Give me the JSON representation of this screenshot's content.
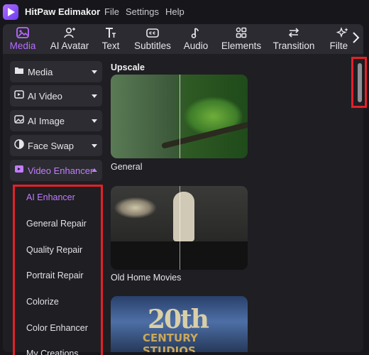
{
  "app": {
    "title": "HitPaw Edimakor"
  },
  "menu": [
    "File",
    "Settings",
    "Help"
  ],
  "toolbar": {
    "tabs": [
      {
        "label": "Media",
        "icon": "media-icon",
        "active": true
      },
      {
        "label": "AI Avatar",
        "icon": "avatar-icon",
        "active": false
      },
      {
        "label": "Text",
        "icon": "text-icon",
        "active": false
      },
      {
        "label": "Subtitles",
        "icon": "subtitles-icon",
        "active": false
      },
      {
        "label": "Audio",
        "icon": "music-note-icon",
        "active": false
      },
      {
        "label": "Elements",
        "icon": "elements-icon",
        "active": false
      },
      {
        "label": "Transition",
        "icon": "transition-icon",
        "active": false
      },
      {
        "label": "Filters",
        "icon": "filters-icon",
        "active": false
      }
    ],
    "more_icon": "chevron-right-icon"
  },
  "sidebar": {
    "categories": [
      {
        "label": "Media",
        "icon": "folder-icon",
        "expanded": false
      },
      {
        "label": "AI Video",
        "icon": "ai-video-icon",
        "expanded": false
      },
      {
        "label": "AI Image",
        "icon": "ai-image-icon",
        "expanded": false
      },
      {
        "label": "Face Swap",
        "icon": "face-swap-icon",
        "expanded": false
      },
      {
        "label": "Video Enhancer",
        "icon": "video-enhancer-icon",
        "expanded": true
      }
    ],
    "submenu": [
      {
        "label": "AI Enhancer",
        "active": true
      },
      {
        "label": "General Repair",
        "active": false
      },
      {
        "label": "Quality Repair",
        "active": false
      },
      {
        "label": "Portrait Repair",
        "active": false
      },
      {
        "label": "Colorize",
        "active": false
      },
      {
        "label": "Color Enhancer",
        "active": false
      },
      {
        "label": "My Creations",
        "active": false
      }
    ]
  },
  "content": {
    "section_title": "Upscale",
    "items": [
      {
        "label": "General"
      },
      {
        "label": "Old Home Movies"
      },
      {
        "label": "",
        "thumb_text": {
          "big": "20th",
          "small": "CENTURY STUDIOS"
        }
      }
    ]
  },
  "colors": {
    "accent": "#c37cff",
    "highlight": "#e4202a",
    "background": "#17171b",
    "panel": "#1e1e23",
    "toolbar": "#2b2b31"
  }
}
